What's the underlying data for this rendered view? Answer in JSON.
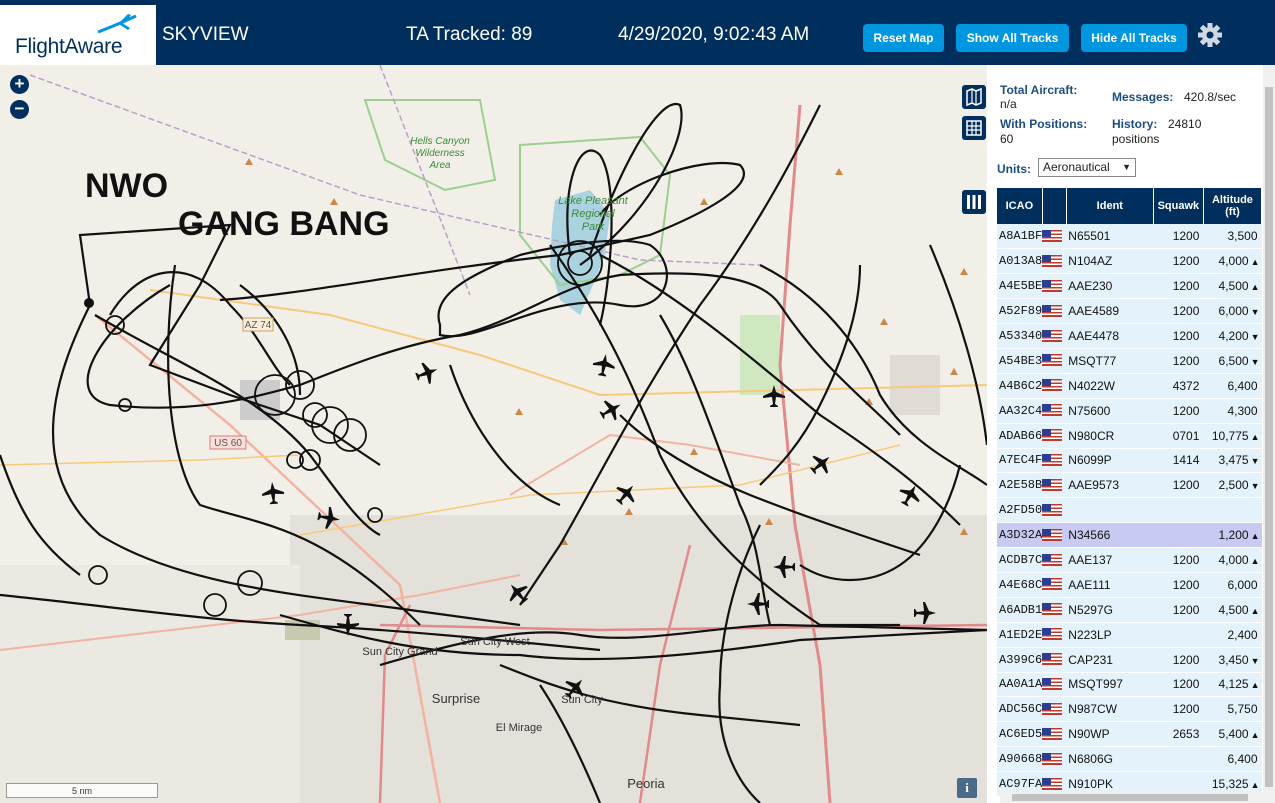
{
  "header": {
    "logo_text": "FlightAware",
    "app_title": "SKYVIEW",
    "ta_tracked": "TA Tracked: 89",
    "datetime": "4/29/2020, 9:02:43 AM",
    "reset_label": "Reset Map",
    "show_label": "Show All Tracks",
    "hide_label": "Hide All Tracks"
  },
  "map": {
    "overlay_line1": "NWO",
    "overlay_line2": "GANG BANG",
    "place_labels": [
      "Hells Canyon",
      "Wilderness",
      "Area",
      "Lake Pleasant",
      "Regional",
      "Park",
      "Sun City West",
      "Sun City Grand",
      "Surprise",
      "El Mirage",
      "Sun City",
      "Peoria"
    ],
    "road_labels": [
      "AZ 74",
      "US 60"
    ],
    "scale_label": "5 nm",
    "info_label": "i"
  },
  "stats": {
    "total_aircraft_label": "Total Aircraft:",
    "total_aircraft_value": "n/a",
    "with_positions_label": "With Positions:",
    "with_positions_value": "60",
    "messages_label": "Messages:",
    "messages_value": "420.8/sec",
    "history_label": "History:",
    "history_value": "24810 positions",
    "units_label": "Units:",
    "units_value": "Aeronautical"
  },
  "table": {
    "headers": {
      "icao": "ICAO",
      "ident": "Ident",
      "squawk": "Squawk",
      "altitude": "Altitude (ft)"
    },
    "rows": [
      {
        "icao": "A8A1BF",
        "ident": "N65501",
        "squawk": "1200",
        "alt": "3,500",
        "trend": ""
      },
      {
        "icao": "A013A8",
        "ident": "N104AZ",
        "squawk": "1200",
        "alt": "4,000",
        "trend": "▲"
      },
      {
        "icao": "A4E5BE",
        "ident": "AAE230",
        "squawk": "1200",
        "alt": "4,500",
        "trend": "▲"
      },
      {
        "icao": "A52F89",
        "ident": "AAE4589",
        "squawk": "1200",
        "alt": "6,000",
        "trend": "▼"
      },
      {
        "icao": "A53340",
        "ident": "AAE4478",
        "squawk": "1200",
        "alt": "4,200",
        "trend": "▼"
      },
      {
        "icao": "A54BE3",
        "ident": "MSQT77",
        "squawk": "1200",
        "alt": "6,500",
        "trend": "▼"
      },
      {
        "icao": "A4B6C2",
        "ident": "N4022W",
        "squawk": "4372",
        "alt": "6,400",
        "trend": ""
      },
      {
        "icao": "AA32C4",
        "ident": "N75600",
        "squawk": "1200",
        "alt": "4,300",
        "trend": ""
      },
      {
        "icao": "ADAB66",
        "ident": "N980CR",
        "squawk": "0701",
        "alt": "10,775",
        "trend": "▲"
      },
      {
        "icao": "A7EC4F",
        "ident": "N6099P",
        "squawk": "1414",
        "alt": "3,475",
        "trend": "▼"
      },
      {
        "icao": "A2E58B",
        "ident": "AAE9573",
        "squawk": "1200",
        "alt": "2,500",
        "trend": "▼"
      },
      {
        "icao": "A2FD50",
        "ident": "",
        "squawk": "",
        "alt": "",
        "trend": ""
      },
      {
        "icao": "A3D32A",
        "ident": "N34566",
        "squawk": "",
        "alt": "1,200",
        "trend": "▲"
      },
      {
        "icao": "ACDB7C",
        "ident": "AAE137",
        "squawk": "1200",
        "alt": "4,000",
        "trend": "▲"
      },
      {
        "icao": "A4E68C",
        "ident": "AAE111",
        "squawk": "1200",
        "alt": "6,000",
        "trend": ""
      },
      {
        "icao": "A6ADB1",
        "ident": "N5297G",
        "squawk": "1200",
        "alt": "4,500",
        "trend": "▲"
      },
      {
        "icao": "A1ED2E",
        "ident": "N223LP",
        "squawk": "",
        "alt": "2,400",
        "trend": ""
      },
      {
        "icao": "A399C6",
        "ident": "CAP231",
        "squawk": "1200",
        "alt": "3,450",
        "trend": "▼"
      },
      {
        "icao": "AA0A1A",
        "ident": "MSQT997",
        "squawk": "1200",
        "alt": "4,125",
        "trend": "▲"
      },
      {
        "icao": "ADC56C",
        "ident": "N987CW",
        "squawk": "1200",
        "alt": "5,750",
        "trend": ""
      },
      {
        "icao": "AC6ED5",
        "ident": "N90WP",
        "squawk": "2653",
        "alt": "5,400",
        "trend": "▲"
      },
      {
        "icao": "A90668",
        "ident": "N6806G",
        "squawk": "",
        "alt": "6,400",
        "trend": ""
      },
      {
        "icao": "AC97FA",
        "ident": "N910PK",
        "squawk": "",
        "alt": "15,325",
        "trend": "▲"
      }
    ],
    "selected_index": 12
  }
}
